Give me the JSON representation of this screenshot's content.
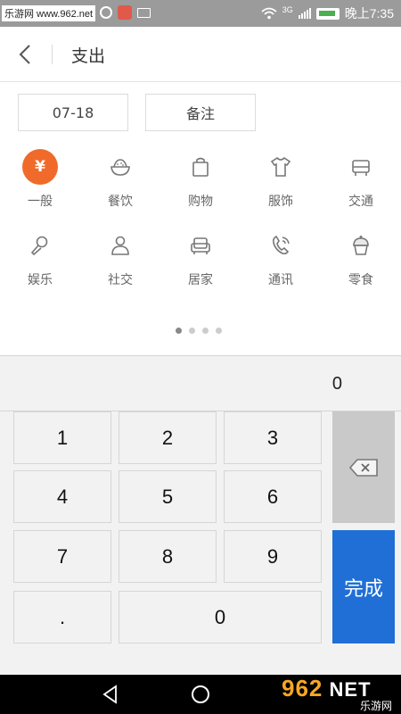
{
  "status_bar": {
    "watermark": "乐游网 www.962.net",
    "network_type": "3G",
    "time": "晚上7:35"
  },
  "header": {
    "title": "支出"
  },
  "controls": {
    "date": "07-18",
    "note": "备注"
  },
  "categories": [
    {
      "label": "一般",
      "icon": "yen-icon",
      "active": true,
      "glyph": "¥"
    },
    {
      "label": "餐饮",
      "icon": "rice-bowl-icon"
    },
    {
      "label": "购物",
      "icon": "shopping-bag-icon"
    },
    {
      "label": "服饰",
      "icon": "shirt-icon"
    },
    {
      "label": "交通",
      "icon": "car-icon"
    },
    {
      "label": "娱乐",
      "icon": "microphone-icon"
    },
    {
      "label": "社交",
      "icon": "people-icon"
    },
    {
      "label": "居家",
      "icon": "sofa-icon"
    },
    {
      "label": "通讯",
      "icon": "phone-icon"
    },
    {
      "label": "零食",
      "icon": "cupcake-icon"
    }
  ],
  "pager": {
    "count": 4,
    "active_index": 0
  },
  "amount": "0",
  "keypad": {
    "keys": [
      "1",
      "2",
      "3",
      "4",
      "5",
      "6",
      "7",
      "8",
      "9",
      ".",
      "0"
    ],
    "done_label": "完成"
  },
  "nav": {
    "brand_number": "962",
    "brand_suffix": "NET",
    "brand_sub": "乐游网"
  },
  "colors": {
    "accent_orange": "#f06b2b",
    "done_blue": "#1f6fd6",
    "status_bar": "#9b9b9b"
  }
}
